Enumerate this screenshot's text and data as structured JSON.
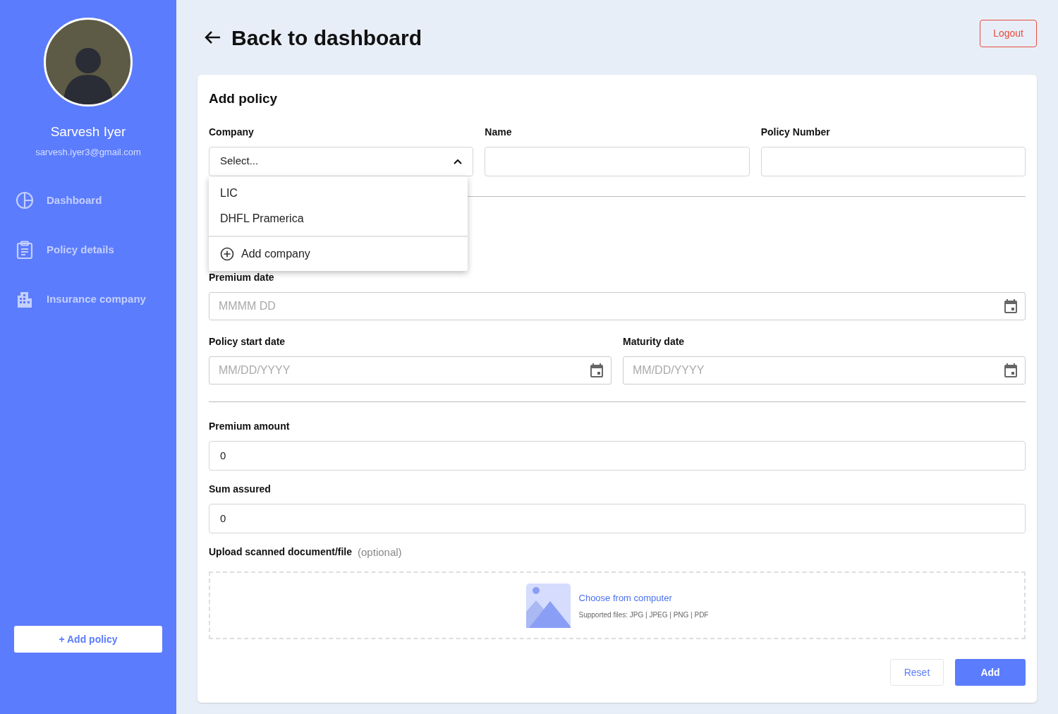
{
  "sidebar": {
    "user": {
      "name": "Sarvesh Iyer",
      "email": "sarvesh.iyer3@gmail.com"
    },
    "items": [
      {
        "label": "Dashboard",
        "kind": "chart"
      },
      {
        "label": "Policy details",
        "kind": "clipboard"
      },
      {
        "label": "Insurance company",
        "kind": "building"
      }
    ],
    "add_button": {
      "icon": "+",
      "label": "Add policy"
    }
  },
  "header": {
    "back_label": "Back to dashboard",
    "logout": "Logout"
  },
  "form": {
    "title": "Add policy",
    "company": {
      "label": "Company",
      "placeholder": "Select...",
      "expanded": true,
      "options": [
        "LIC",
        "DHFL Pramerica"
      ],
      "add_option": "Add company"
    },
    "name": {
      "label": "Name"
    },
    "policy_number": {
      "label": "Policy Number"
    },
    "premium_date": {
      "label": "Premium date",
      "placeholder": "MMMM DD"
    },
    "policy_start_date": {
      "label": "Policy start date",
      "placeholder": "MM/DD/YYYY"
    },
    "maturity_date": {
      "label": "Maturity date",
      "placeholder": "MM/DD/YYYY"
    },
    "premium_amount": {
      "label": "Premium amount",
      "value": "0"
    },
    "sum_assured": {
      "label": "Sum assured",
      "value": "0"
    },
    "upload": {
      "label": "Upload scanned document/file",
      "hint": "(optional)",
      "link": "Choose from computer",
      "supported": "Supported files: JPG | JPEG | PNG | PDF"
    },
    "buttons": {
      "reset": "Reset",
      "add": "Add"
    }
  }
}
